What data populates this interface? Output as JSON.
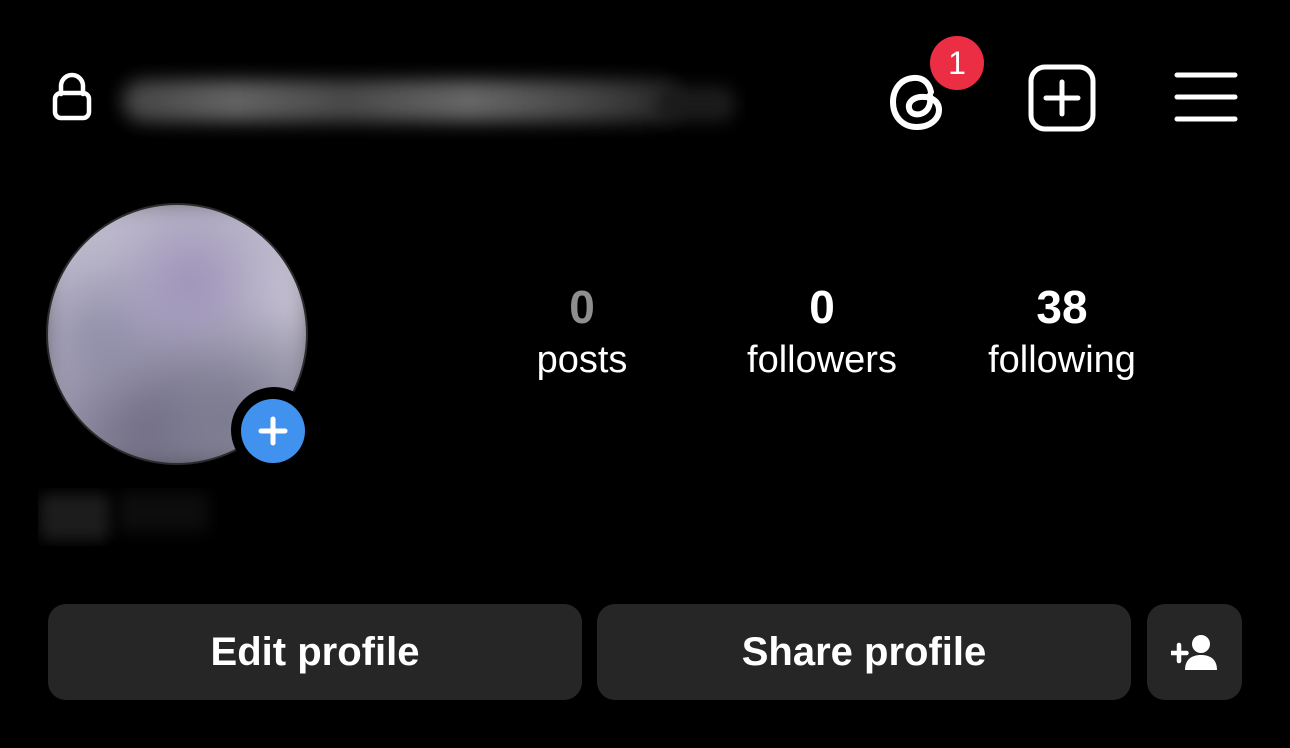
{
  "header": {
    "icons": {
      "lock": "lock-icon",
      "threads": "threads-icon",
      "new_post": "plus-square-icon",
      "menu": "hamburger-menu-icon"
    },
    "notification_count": "1"
  },
  "profile": {
    "add_story_icon": "plus-icon"
  },
  "stats": {
    "posts": {
      "count": "0",
      "label": "posts"
    },
    "followers": {
      "count": "0",
      "label": "followers"
    },
    "following": {
      "count": "38",
      "label": "following"
    }
  },
  "actions": {
    "edit_label": "Edit profile",
    "share_label": "Share profile",
    "discover_icon": "add-person-icon"
  },
  "colors": {
    "background": "#000000",
    "button_bg": "#262626",
    "badge": "#ec2e45",
    "story_add_blue": "#4191ef",
    "muted_count": "#8e8e8e"
  }
}
